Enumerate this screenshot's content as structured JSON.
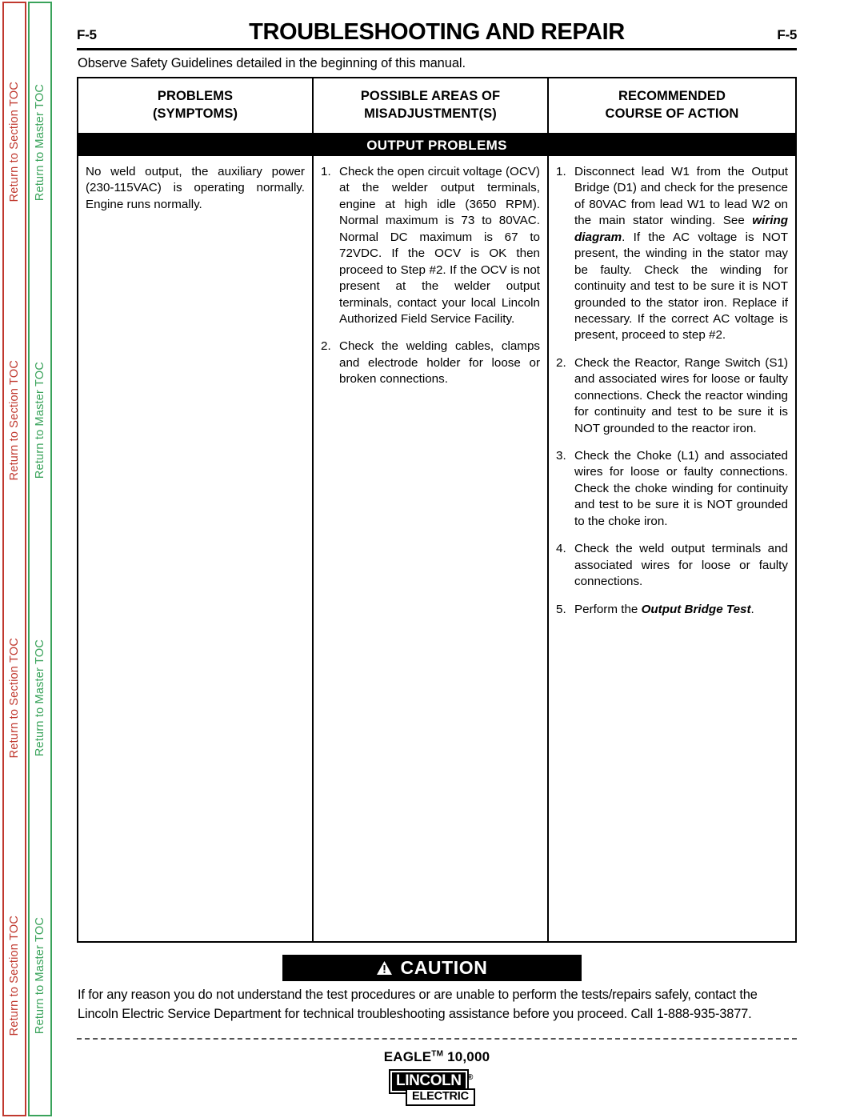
{
  "nav": {
    "section_toc_label": "Return to Section TOC",
    "master_toc_label": "Return to Master TOC",
    "repeat_count": 4,
    "section_toc_color": "#c0392f",
    "master_toc_color": "#3aa35b"
  },
  "header": {
    "folio_left": "F-5",
    "folio_right": "F-5",
    "title": "TROUBLESHOOTING AND REPAIR",
    "safety_note": "Observe Safety Guidelines detailed in the beginning of this manual."
  },
  "table": {
    "columns": [
      {
        "line1": "PROBLEMS",
        "line2": "(SYMPTOMS)"
      },
      {
        "line1": "POSSIBLE AREAS OF",
        "line2": "MISADJUSTMENT(S)"
      },
      {
        "line1": "RECOMMENDED",
        "line2": "COURSE OF ACTION"
      }
    ],
    "section_band": "OUTPUT PROBLEMS",
    "symptom": "No weld output, the auxiliary power (230-115VAC) is operating normally.  Engine runs normally.",
    "misadjustments": [
      {
        "num": "1.",
        "text": "Check the open circuit voltage (OCV) at the welder output terminals, engine at high idle (3650 RPM).  Normal maximum is 73 to 80VAC.  Normal DC maximum is 67 to 72VDC.  If the OCV is OK then proceed to Step #2.  If the OCV is not present at the welder output terminals, contact your local Lincoln Authorized Field Service Facility."
      },
      {
        "num": "2.",
        "text": "Check the welding cables, clamps and electrode holder for loose or broken connections."
      }
    ],
    "actions": [
      {
        "num": "1.",
        "parts": [
          {
            "t": "Disconnect lead W1 from the Output Bridge (D1) and check for the presence of 80VAC from lead W1 to lead W2 on the main stator winding.  See ",
            "b": false
          },
          {
            "t": "wiring diagram",
            "b": true
          },
          {
            "t": ".  If the AC voltage is NOT present, the winding in the stator may be faulty.  Check the winding for continuity and test to be sure it is NOT grounded to the stator iron.  Replace if necessary.  If the correct AC voltage is present, proceed to step #2.",
            "b": false
          }
        ]
      },
      {
        "num": "2.",
        "parts": [
          {
            "t": "Check the Reactor, Range Switch (S1) and associated wires for loose or faulty connections.  Check the reactor winding for continuity and test to be sure it is NOT grounded to the reactor iron.",
            "b": false
          }
        ]
      },
      {
        "num": "3.",
        "parts": [
          {
            "t": "Check the Choke (L1) and associated wires for loose or faulty connections.  Check the choke winding for continuity and test to be sure it is NOT grounded to the choke iron.",
            "b": false
          }
        ]
      },
      {
        "num": "4.",
        "parts": [
          {
            "t": "Check the weld output terminals and associated wires for loose or faulty connections.",
            "b": false
          }
        ]
      },
      {
        "num": "5.",
        "parts": [
          {
            "t": "Perform the ",
            "b": false
          },
          {
            "t": "Output Bridge Test",
            "b": true
          },
          {
            "t": ".",
            "b": false
          }
        ]
      }
    ]
  },
  "caution": {
    "icon": "warning-triangle-icon",
    "label": "CAUTION",
    "body": "If for any reason you do not understand the test procedures or are unable to perform the tests/repairs safely, contact the Lincoln Electric Service Department for technical troubleshooting assistance before you proceed.  Call 1-888-935-3877."
  },
  "footer": {
    "model": "EAGLE",
    "model_tm": "TM",
    "model_number": " 10,000",
    "logo_primary": "LINCOLN",
    "logo_registered": "®",
    "logo_secondary": "ELECTRIC"
  }
}
